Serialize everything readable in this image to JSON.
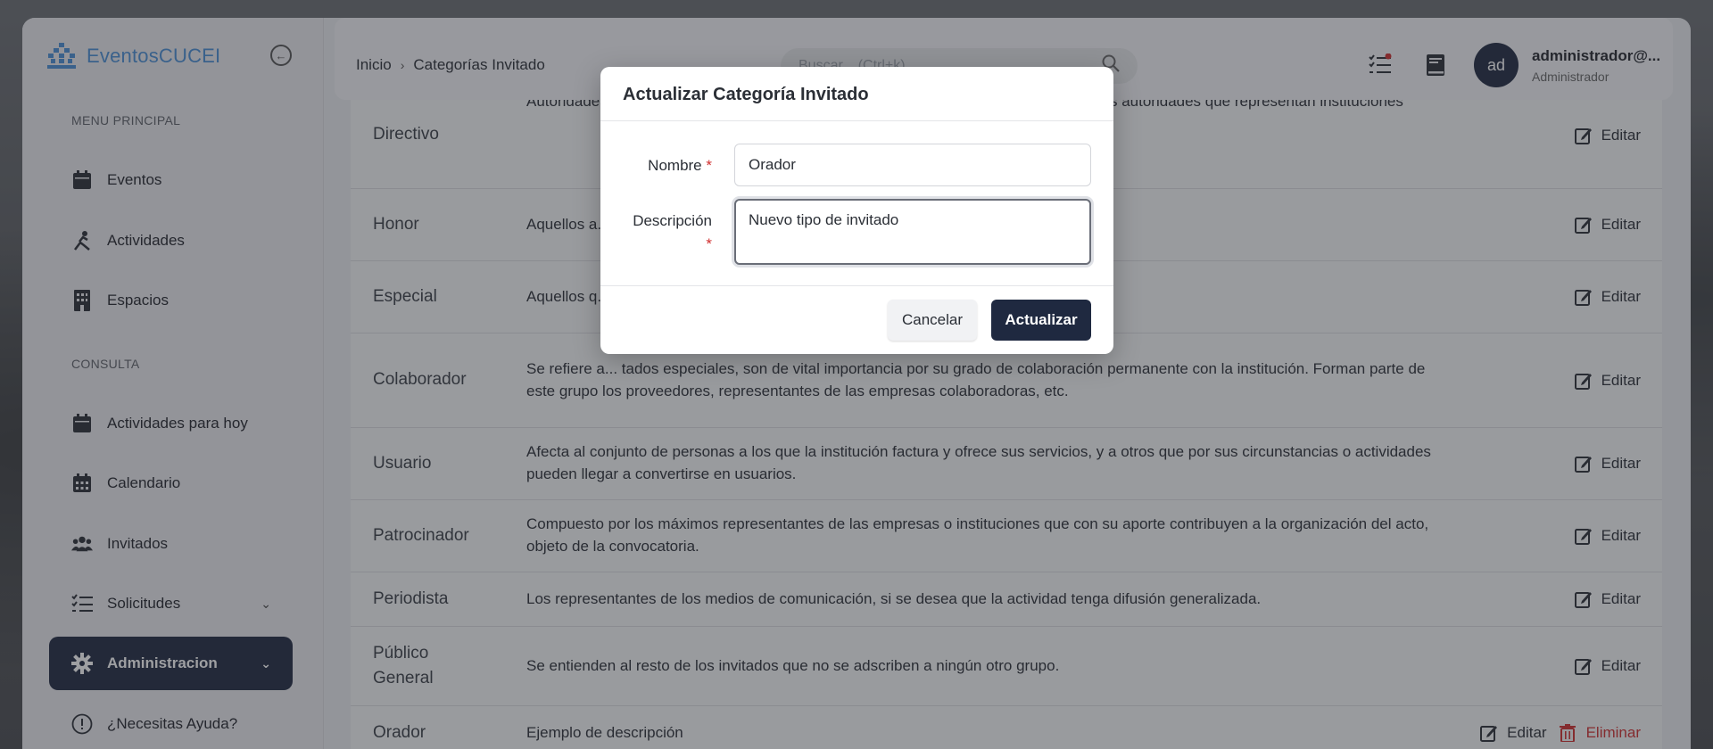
{
  "brand": {
    "name": "EventosCUCEI"
  },
  "sidebar": {
    "section_main": "MENU PRINCIPAL",
    "section_query": "CONSULTA",
    "items": [
      {
        "label": "Eventos",
        "icon": "calendar-icon"
      },
      {
        "label": "Actividades",
        "icon": "activity-icon"
      },
      {
        "label": "Espacios",
        "icon": "building-icon"
      },
      {
        "label": "Actividades para hoy",
        "icon": "calendar-icon"
      },
      {
        "label": "Calendario",
        "icon": "calendar-grid-icon"
      },
      {
        "label": "Invitados",
        "icon": "users-icon"
      },
      {
        "label": "Solicitudes",
        "icon": "checklist-icon"
      },
      {
        "label": "Administracion",
        "icon": "gear-icon"
      },
      {
        "label": "¿Necesitas Ayuda?",
        "icon": "help-icon"
      }
    ]
  },
  "header": {
    "breadcrumb": [
      "Inicio",
      "Categorías Invitado"
    ],
    "search_placeholder": "Buscar... (Ctrl+k)",
    "user": {
      "initials": "ad",
      "name": "administrador@...",
      "role": "Administrador"
    }
  },
  "table": {
    "edit_label": "Editar",
    "delete_label": "Eliminar",
    "rows": [
      {
        "name": "Directivo",
        "description": "Autoridades ... ido a la realización del hecho que motiva el acto o que ... nente, aquellas autoridades que representan instituciones"
      },
      {
        "name": "Honor",
        "description": "Aquellos a... no grado de colaboración tal distinción o que con su pres..."
      },
      {
        "name": "Especial",
        "description": "Aquellos q... institución, su reconocimiento social, cultural, etc. Son cl..."
      },
      {
        "name": "Colaborador",
        "description": "Se refiere a... tados especiales, son de vital importancia por su grado de colaboración permanente con la institución. Forman parte de este grupo los proveedores, representantes de las empresas colaboradoras, etc."
      },
      {
        "name": "Usuario",
        "description": "Afecta al conjunto de personas a los que la institución factura y ofrece sus servicios, y a otros que por sus circunstancias o actividades pueden llegar a convertirse en usuarios."
      },
      {
        "name": "Patrocinador",
        "description": "Compuesto por los máximos representantes de las empresas o instituciones que con su aporte contribuyen a la organización del acto, objeto de la convocatoria."
      },
      {
        "name": "Periodista",
        "description": "Los representantes de los medios de comunicación, si se desea que la actividad tenga difusión generalizada."
      },
      {
        "name": "Público General",
        "description": "Se entienden al resto de los invitados que no se adscriben a ningún otro grupo."
      },
      {
        "name": "Orador",
        "description": "Ejemplo de descripción"
      }
    ]
  },
  "modal": {
    "title": "Actualizar Categoría Invitado",
    "name_label": "Nombre",
    "name_value": "Orador",
    "desc_label": "Descripción",
    "desc_value": "Nuevo tipo de invitado",
    "required_mark": "*",
    "cancel_label": "Cancelar",
    "update_label": "Actualizar"
  },
  "colors": {
    "primary": "#1f2940",
    "brand": "#4a8fd6",
    "danger": "#d02f2f"
  }
}
